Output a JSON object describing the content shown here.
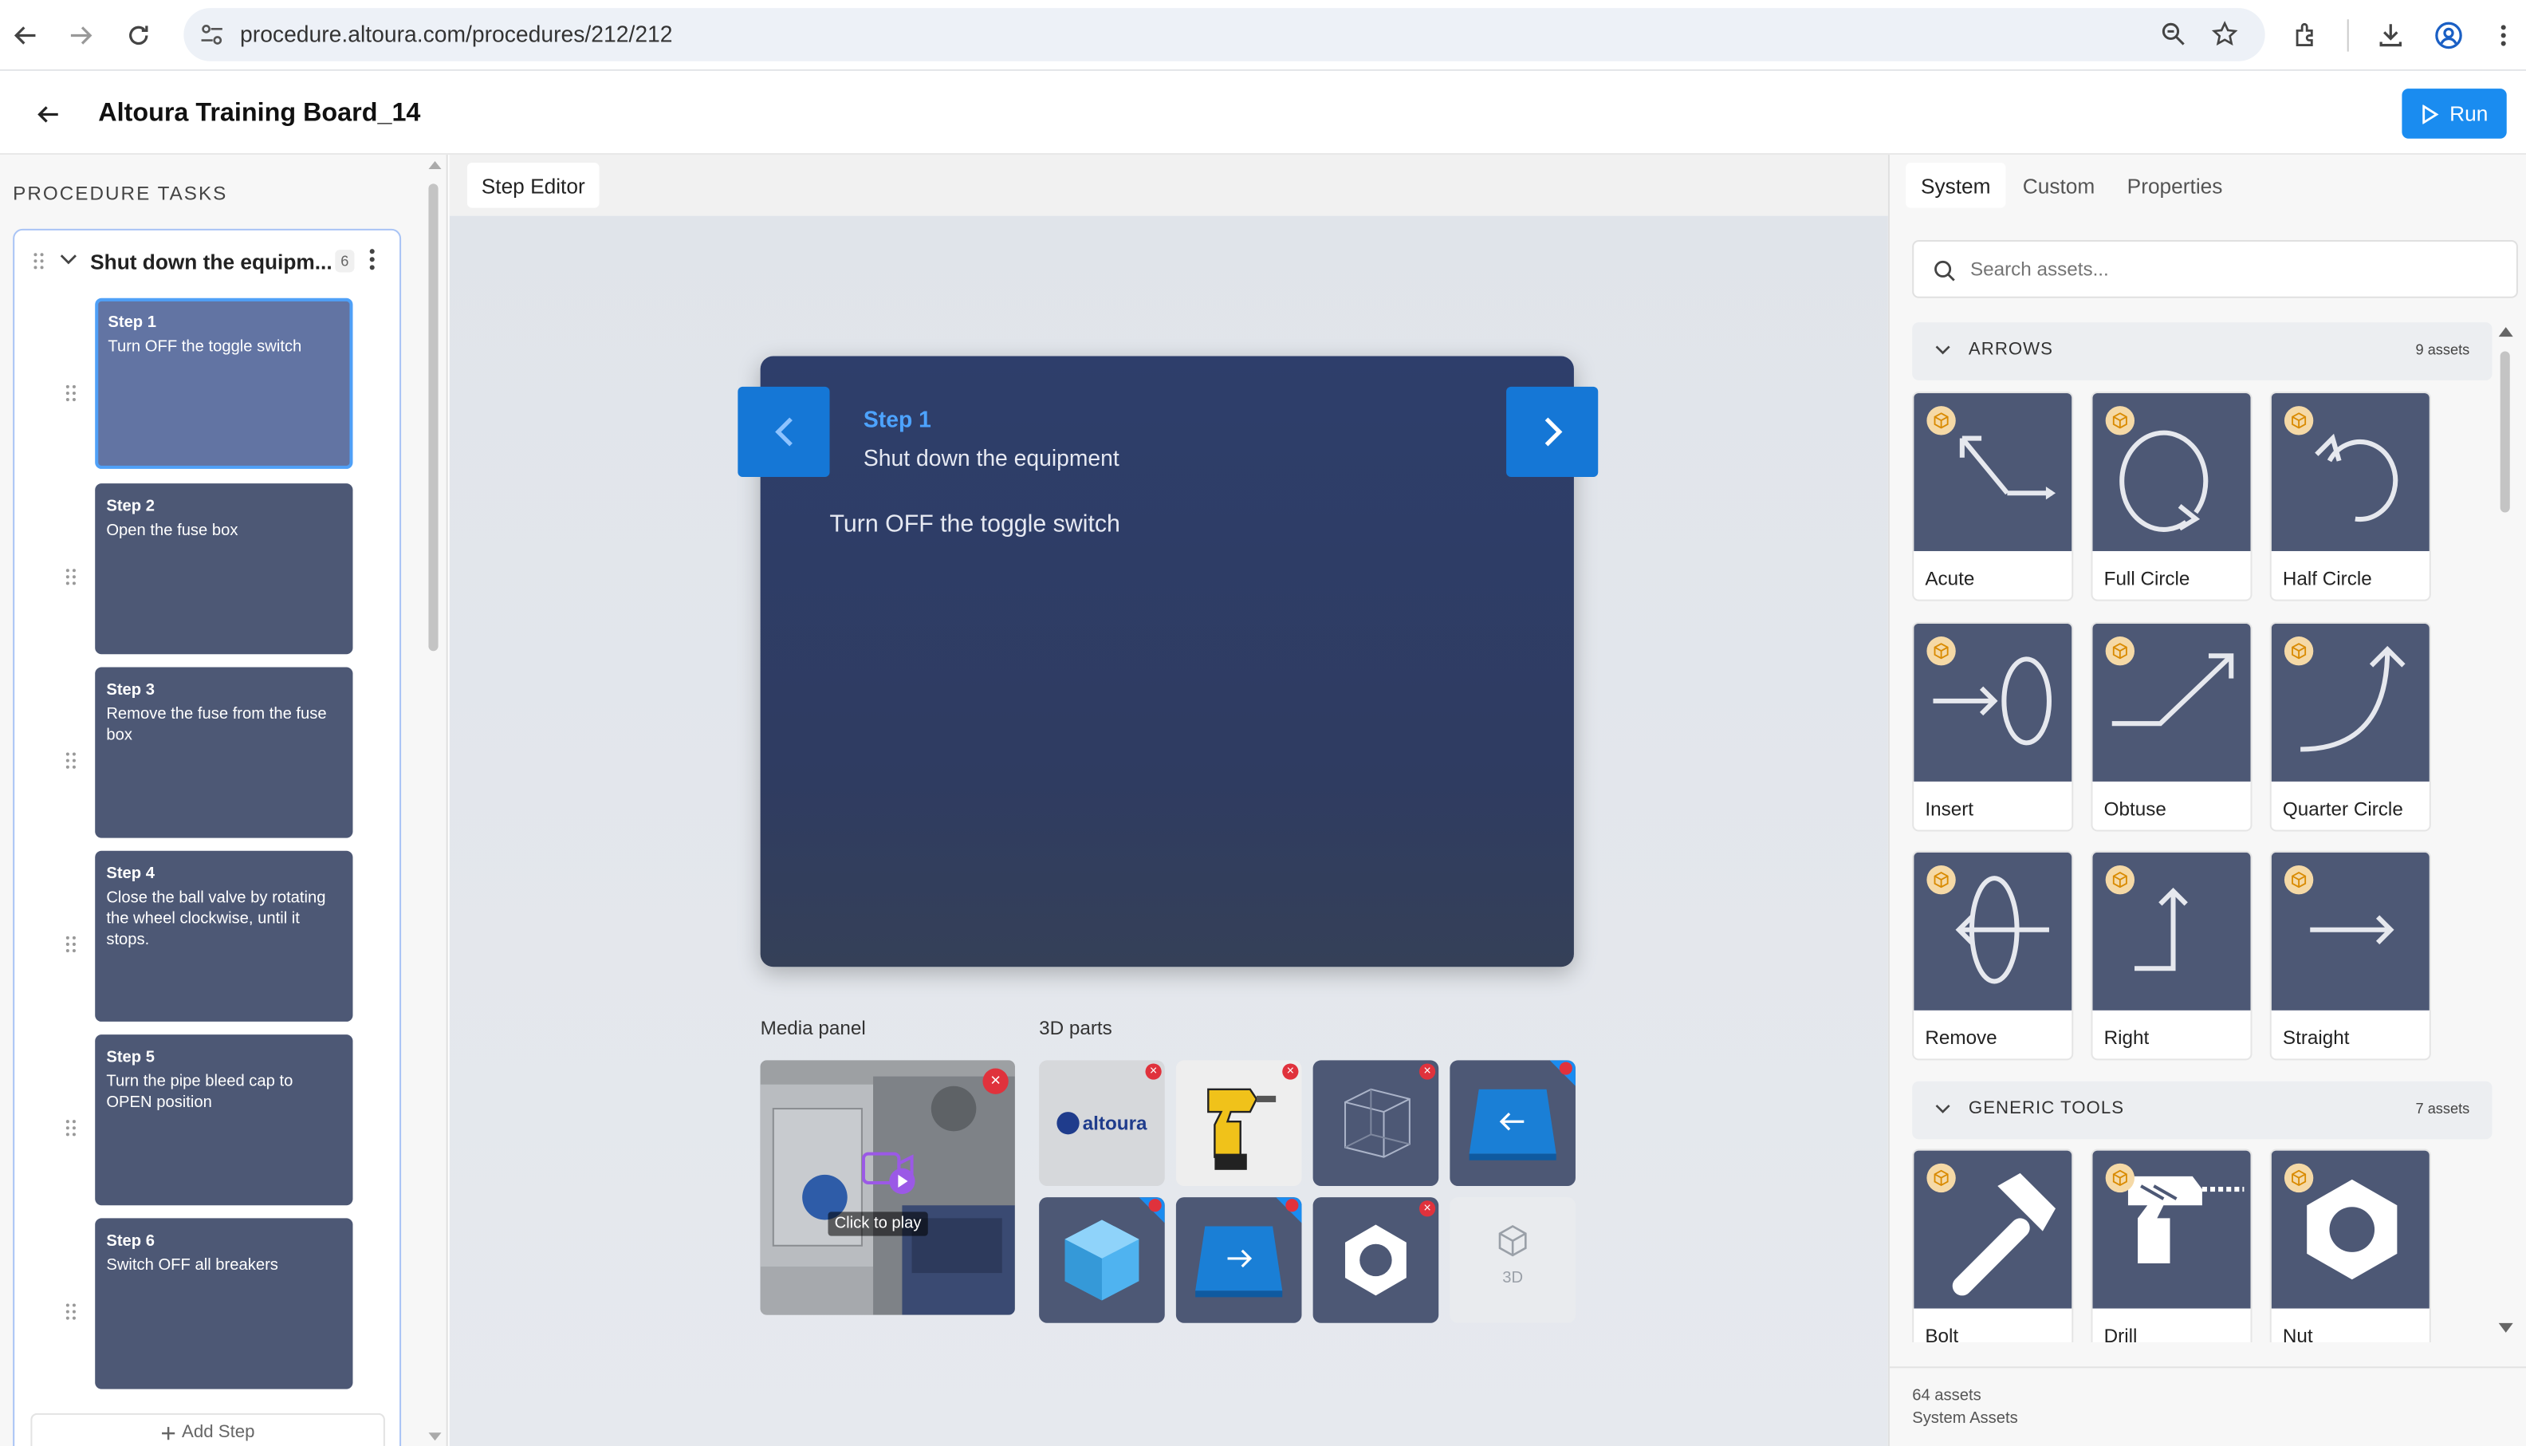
{
  "browser": {
    "url": "procedure.altoura.com/procedures/212/212"
  },
  "header": {
    "title": "Altoura Training Board_14",
    "run_label": "Run"
  },
  "left_panel": {
    "heading": "PROCEDURE TASKS",
    "task": {
      "title": "Shut down the equipm...",
      "count": "6"
    },
    "steps": [
      {
        "number": "Step 1",
        "text": "Turn OFF the toggle switch"
      },
      {
        "number": "Step 2",
        "text": "Open the fuse box"
      },
      {
        "number": "Step 3",
        "text": "Remove the fuse from the fuse box"
      },
      {
        "number": "Step 4",
        "text": "Close the ball valve by rotating the wheel clockwise, until it stops."
      },
      {
        "number": "Step 5",
        "text": "Turn the pipe bleed cap to OPEN position"
      },
      {
        "number": "Step 6",
        "text": "Switch OFF all breakers"
      }
    ],
    "add_step_label": "Add Step"
  },
  "editor": {
    "tab_label": "Step Editor",
    "card": {
      "step_label": "Step 1",
      "title": "Shut down the equipment",
      "instruction": "Turn OFF the toggle switch"
    },
    "media_panel_label": "Media panel",
    "click_to_play": "Click to play",
    "parts_label": "3D parts",
    "parts": [
      {
        "icon": "altoura-logo-icon"
      },
      {
        "icon": "drill-icon"
      },
      {
        "icon": "wire-cube-icon"
      },
      {
        "icon": "arrow-left-plate-icon"
      },
      {
        "icon": "blue-cube-icon"
      },
      {
        "icon": "arrow-right-plate-icon"
      },
      {
        "icon": "nut-icon"
      },
      {
        "icon": "add-3d-icon",
        "label": "3D"
      }
    ]
  },
  "right_panel": {
    "tabs": [
      "System",
      "Custom",
      "Properties"
    ],
    "search_placeholder": "Search assets...",
    "categories": [
      {
        "name": "ARROWS",
        "count": "9 assets",
        "assets": [
          "Acute",
          "Full Circle",
          "Half Circle",
          "Insert",
          "Obtuse",
          "Quarter Circle",
          "Remove",
          "Right",
          "Straight"
        ]
      },
      {
        "name": "GENERIC TOOLS",
        "count": "7 assets",
        "assets": [
          "Bolt",
          "Drill",
          "Nut"
        ]
      }
    ],
    "footer_count": "64 assets",
    "footer_source": "System Assets"
  },
  "colors": {
    "accent": "#1a8cf0",
    "step_card": "#4d5875",
    "active_step": "#6274a3",
    "card_bg": "#2e3e6b",
    "step_link": "#4da3ff",
    "delete_badge": "#e0323c"
  }
}
